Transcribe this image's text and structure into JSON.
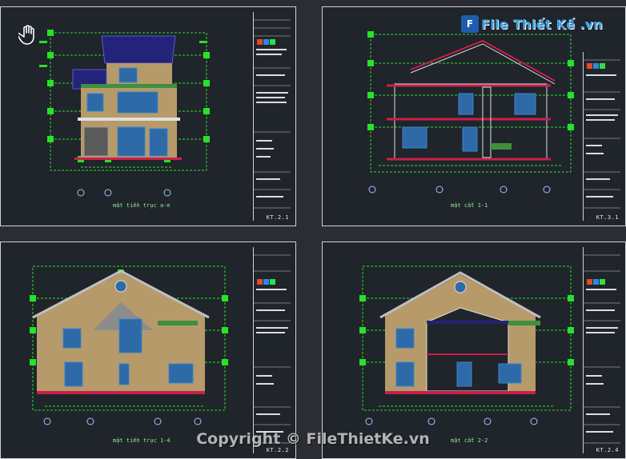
{
  "watermark_logo": "File Thiết Kế .vn",
  "copyright": "Copyright © FileThietKe.vn",
  "colors": {
    "background": "#2b2d33",
    "sheet": "#20242b",
    "dimension": "#27e227",
    "wall": "#b79a6a",
    "roof": "#23237a",
    "glass": "#2e6aa8",
    "frame": "#3a86c8",
    "section_cut": "#c8204a",
    "plant": "#3f8f3f"
  },
  "sheets": [
    {
      "id": "s1",
      "caption": "mặt tiền trục a-e",
      "code": "KT.2.1"
    },
    {
      "id": "s2",
      "caption": "mặt cắt 1-1",
      "code": "KT.3.1"
    },
    {
      "id": "s3",
      "caption": "mặt tiền trục 1-4",
      "code": "KT.2.2"
    },
    {
      "id": "s4",
      "caption": "mặt cắt 2-2",
      "code": "KT.2.4"
    }
  ]
}
